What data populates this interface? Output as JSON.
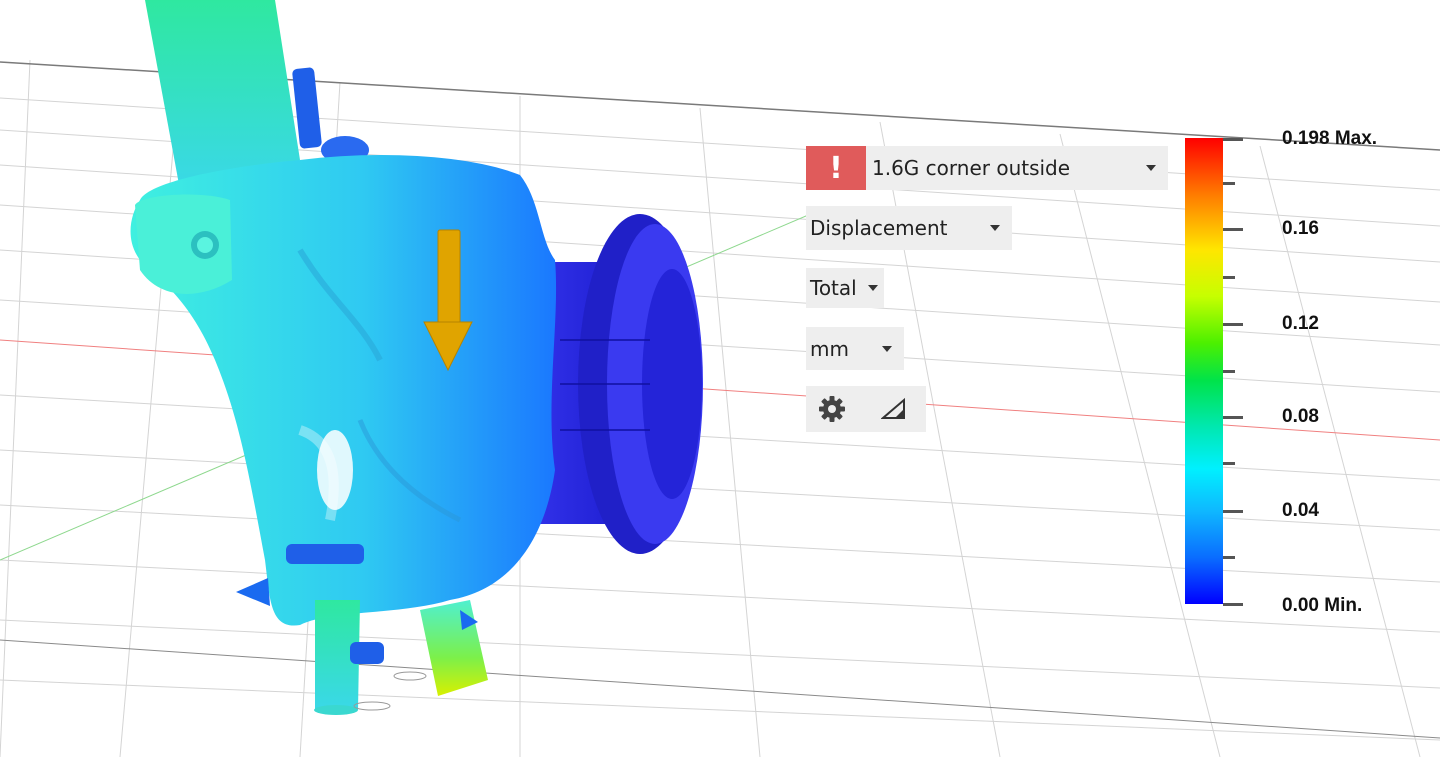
{
  "toolbar": {
    "load_case": "1.6G corner outside",
    "warning_glyph": "!",
    "result_type": "Displacement",
    "component": "Total",
    "units": "mm",
    "settings_icon": "gear-icon",
    "toggle_icon": "triangle-ramp-icon"
  },
  "legend": {
    "max_label": "0.198 Max.",
    "labels": [
      "0.16",
      "0.12",
      "0.08",
      "0.04"
    ],
    "min_label": "0.00 Min.",
    "colors": [
      "#ff0000",
      "#ffe600",
      "#4cf000",
      "#00f0ff",
      "#0a6dff",
      "#0000ff"
    ]
  },
  "colors": {
    "warning": "#e05b5b",
    "load_arrow": "#e0a400",
    "fixture": "#1a2be0"
  }
}
